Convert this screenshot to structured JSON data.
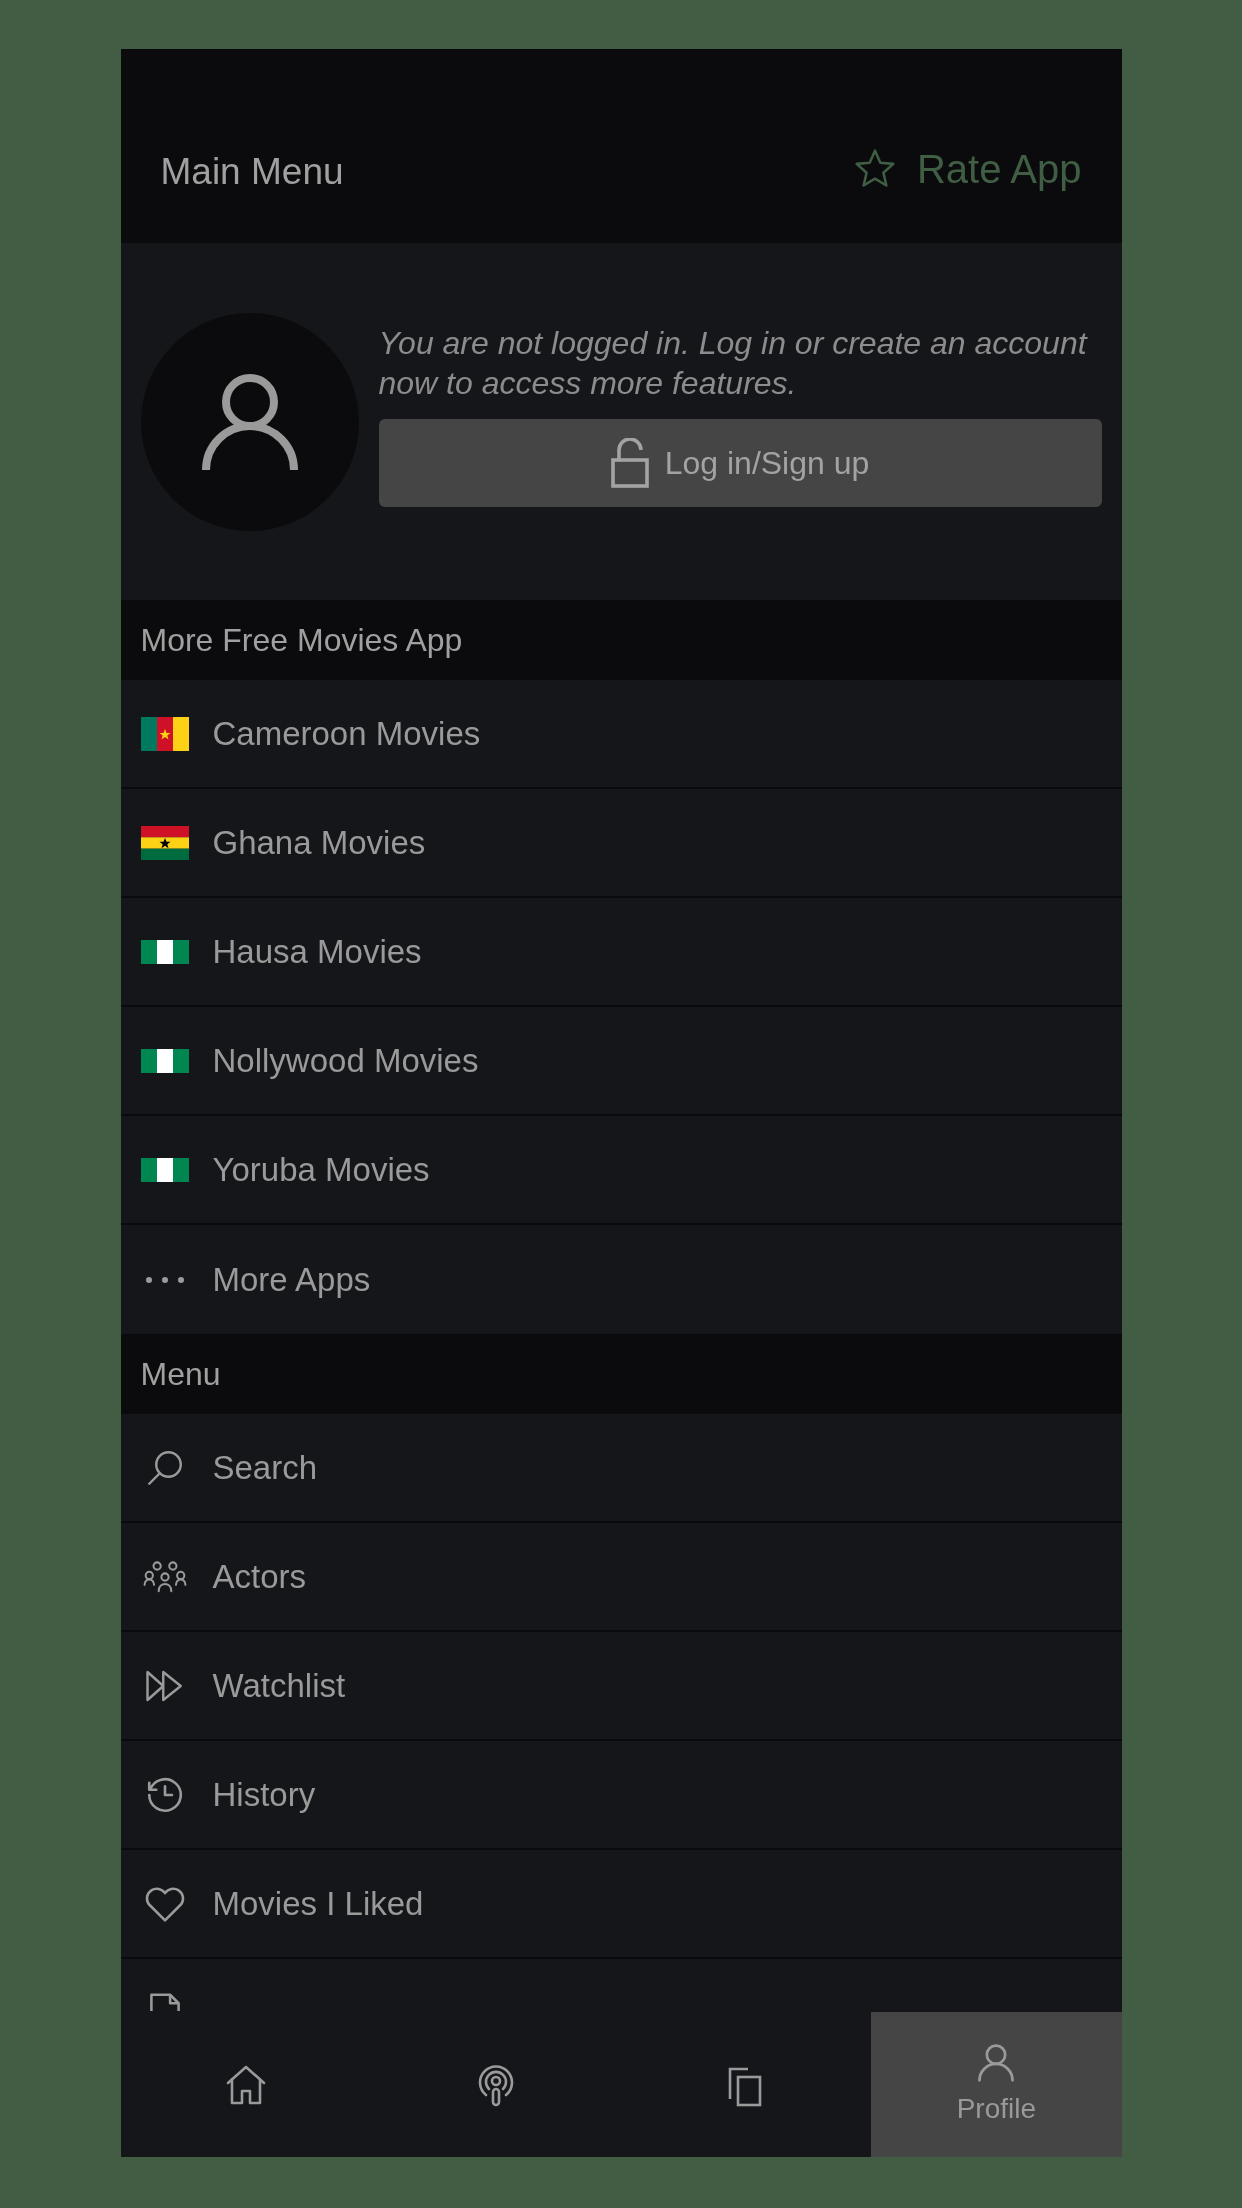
{
  "header": {
    "title": "Main Menu",
    "rate_button": "Rate App"
  },
  "account": {
    "message": "You are not logged in. Log in or create an account now to access more features.",
    "login_button": "Log in/Sign up"
  },
  "sections": [
    {
      "title": "More Free Movies App",
      "items": [
        {
          "label": "Cameroon Movies"
        },
        {
          "label": "Ghana Movies"
        },
        {
          "label": "Hausa Movies"
        },
        {
          "label": "Nollywood Movies"
        },
        {
          "label": "Yoruba Movies"
        },
        {
          "label": "More Apps"
        }
      ]
    },
    {
      "title": "Menu",
      "items": [
        {
          "label": "Search"
        },
        {
          "label": "Actors"
        },
        {
          "label": "Watchlist"
        },
        {
          "label": "History"
        },
        {
          "label": "Movies I Liked"
        }
      ]
    }
  ],
  "bottom_nav": [
    {
      "selected": false
    },
    {
      "selected": false
    },
    {
      "selected": false
    },
    {
      "label": "Profile",
      "selected": true
    }
  ]
}
